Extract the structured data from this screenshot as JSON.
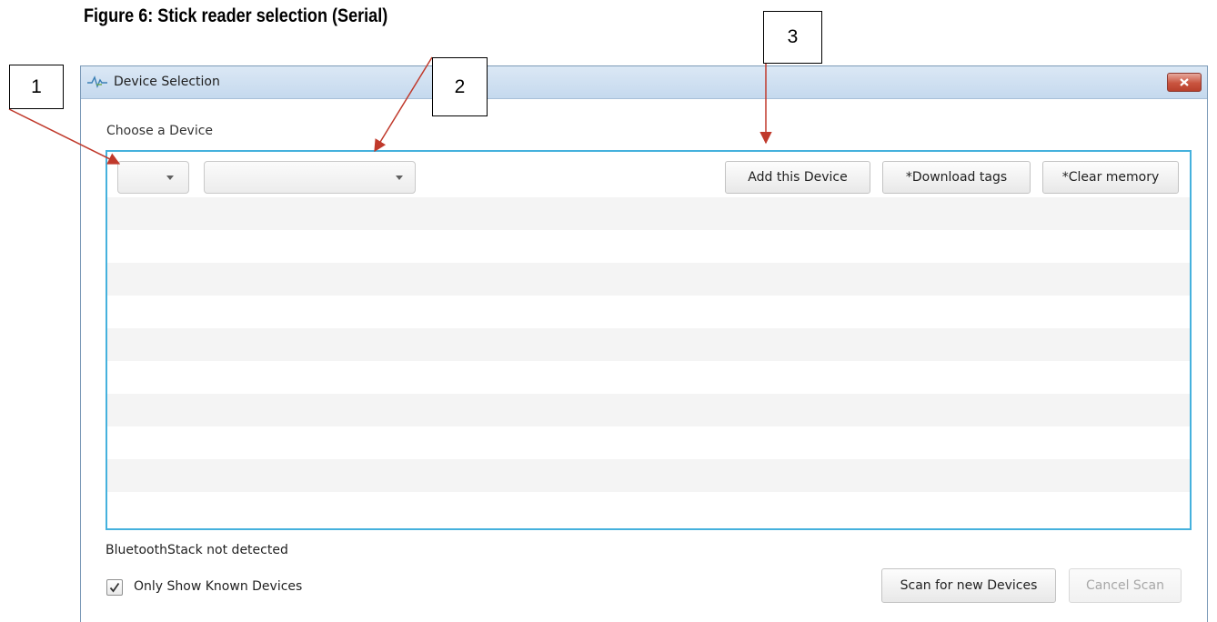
{
  "figure": {
    "caption": "Figure 6: Stick reader selection (Serial)"
  },
  "callouts": [
    "1",
    "2",
    "3"
  ],
  "window": {
    "title": "Device Selection",
    "title_icon": "signal-wave-icon",
    "close_icon": "close-icon"
  },
  "device_chooser": {
    "label": "Choose a Device",
    "port_select_value": "",
    "device_select_value": "",
    "buttons": {
      "add": "Add this Device",
      "download": "*Download tags",
      "clear": "*Clear memory"
    }
  },
  "status": {
    "bluetooth": "BluetoothStack not detected"
  },
  "filter": {
    "label": "Only Show Known Devices",
    "checked": true
  },
  "footer": {
    "scan": "Scan for new Devices",
    "cancel": "Cancel Scan",
    "cancel_disabled": true
  },
  "colors": {
    "panel_border": "#45b1dd",
    "arrow": "#c0392b",
    "close_button": "#c9543f"
  }
}
